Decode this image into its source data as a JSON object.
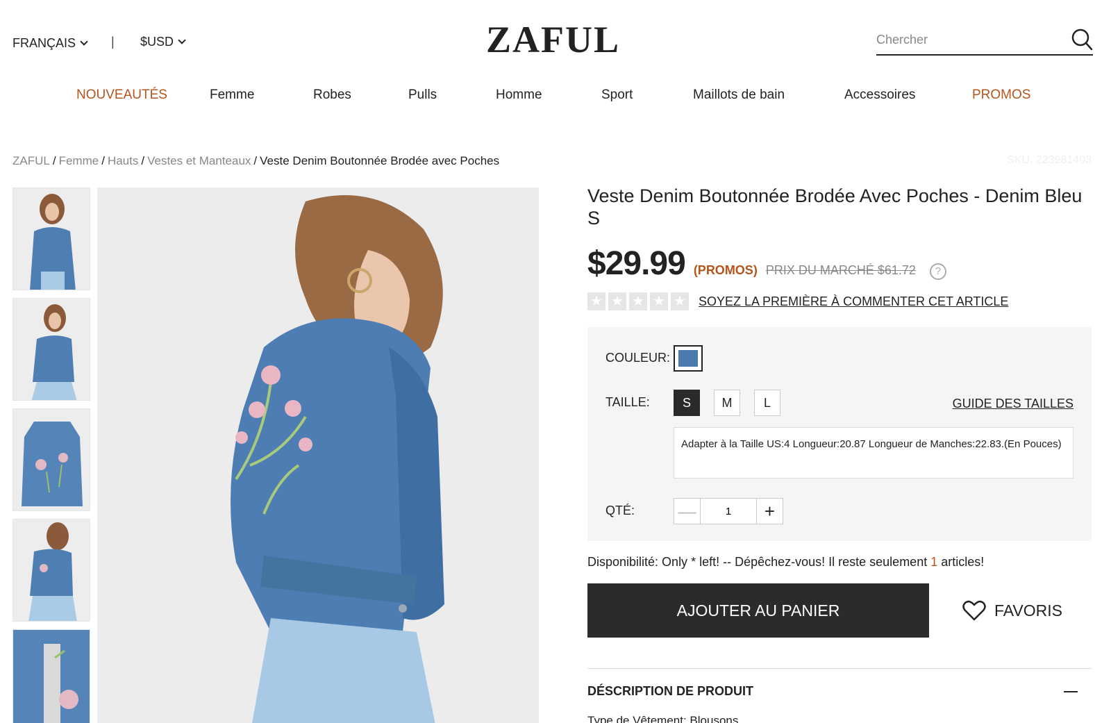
{
  "header": {
    "language": "FRANÇAIS",
    "separator": "|",
    "currency": "$USD",
    "logo": "ZAFUL",
    "search_placeholder": "Chercher"
  },
  "nav": {
    "items": [
      {
        "label": "NOUVEAUTÉS"
      },
      {
        "label": "Femme"
      },
      {
        "label": "Robes"
      },
      {
        "label": "Pulls"
      },
      {
        "label": "Homme"
      },
      {
        "label": "Sport"
      },
      {
        "label": "Maillots de bain"
      },
      {
        "label": "Accessoires"
      },
      {
        "label": "PROMOS"
      }
    ],
    "accent_color": "#b5541b"
  },
  "breadcrumb": {
    "items": [
      "ZAFUL",
      "Femme",
      "Hauts",
      "Vestes et Manteaux"
    ],
    "current": "Veste Denim Boutonnée Brodée avec Poches",
    "separator": "/"
  },
  "sku": "SKU: 223981403",
  "product": {
    "title": "Veste Denim Boutonnée Brodée Avec Poches - Denim Bleu S",
    "price": "$29.99",
    "promo_tag": "(PROMOS)",
    "market_price": "PRIX DU MARCHÉ $61.72",
    "help_icon": "?",
    "rating_stars": 0,
    "review_link": "SOYEZ LA PREMIÈRE À COMMENTER CET ARTICLE"
  },
  "options": {
    "color_label": "COULEUR:",
    "color_swatch": "#4a7ab0",
    "size_label": "TAILLE:",
    "sizes": [
      "S",
      "M",
      "L"
    ],
    "selected_size": "S",
    "size_guide": "GUIDE DES TAILLES",
    "size_info": "Adapter à la Taille US:4   Longueur:20.87   Longueur de Manches:22.83.(En Pouces)",
    "qty_label": "QTÉ:",
    "qty_value": "1",
    "qty_minus": "—",
    "qty_plus": "+"
  },
  "availability": {
    "text_before": "Disponibilité: Only * left! -- Dépêchez-vous! Il reste seulement ",
    "count": "1",
    "text_after": " articles!"
  },
  "actions": {
    "add_to_cart": "AJOUTER AU PANIER",
    "favorites": "FAVORIS"
  },
  "description": {
    "heading": "DÉSCRIPTION DE PRODUIT",
    "first_line": "Type de Vêtement: Blousons"
  }
}
